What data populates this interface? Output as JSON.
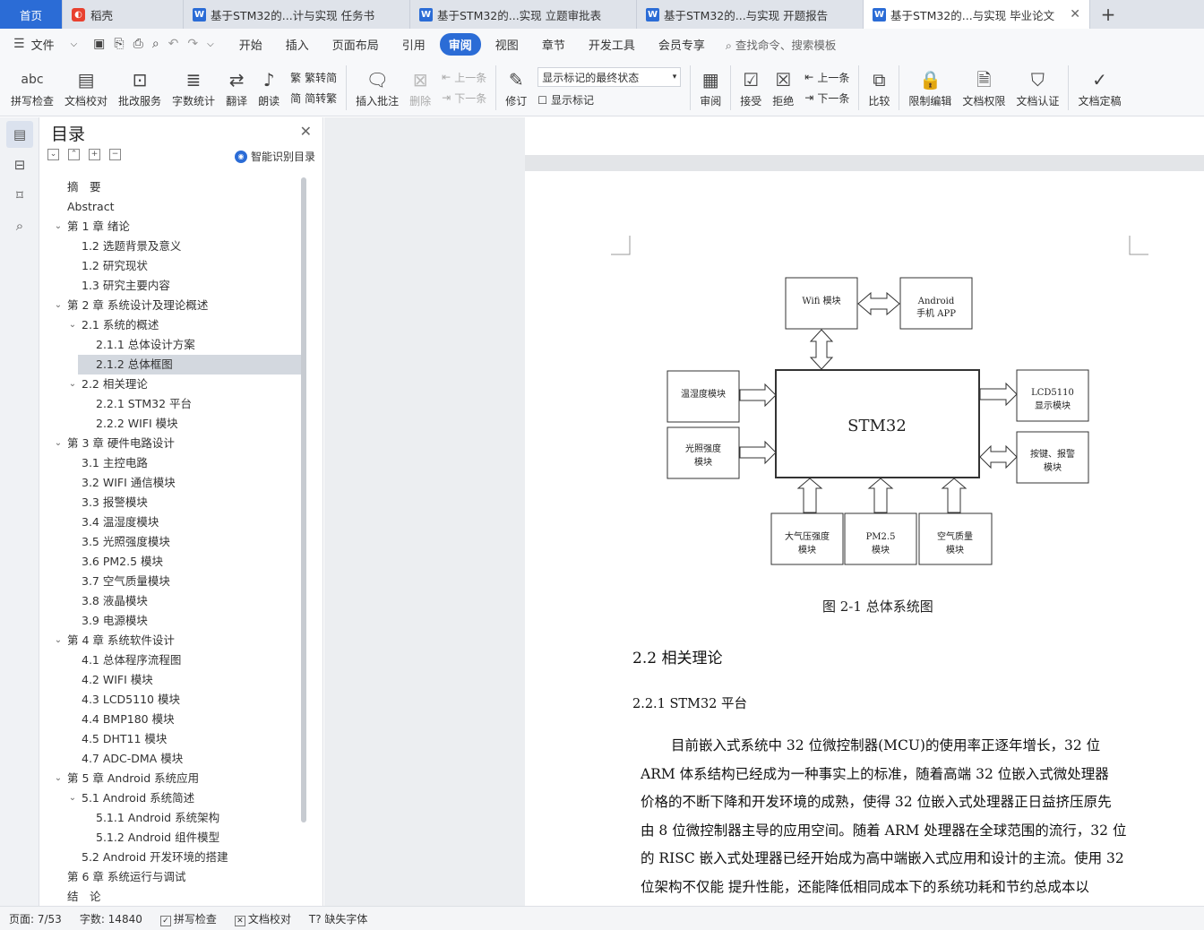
{
  "tabs": [
    {
      "label": "首页",
      "kind": "home"
    },
    {
      "label": "稻壳",
      "kind": "docer"
    },
    {
      "label": "基于STM32的...计与实现 任务书",
      "kind": "doc"
    },
    {
      "label": "基于STM32的...实现 立题审批表",
      "kind": "doc"
    },
    {
      "label": "基于STM32的...与实现 开题报告",
      "kind": "doc"
    },
    {
      "label": "基于STM32的...与实现 毕业论文",
      "kind": "doc",
      "active": true
    }
  ],
  "menu": {
    "file": "文件",
    "items": [
      "开始",
      "插入",
      "页面布局",
      "引用",
      "审阅",
      "视图",
      "章节",
      "开发工具",
      "会员专享"
    ],
    "active": "审阅",
    "search": "查找命令、搜索模板"
  },
  "ribbon": {
    "spell": "拼写检查",
    "proof": "文档校对",
    "review_service": "批改服务",
    "word_count": "字数统计",
    "translate": "翻译",
    "read_aloud": "朗读",
    "to_trad": "繁转简",
    "to_simp": "简转繁",
    "insert_comment": "插入批注",
    "delete": "删除",
    "prev": "上一条",
    "next": "下一条",
    "track": "修订",
    "markup_select": "显示标记的最终状态",
    "show_markup": "显示标记",
    "review": "审阅",
    "accept": "接受",
    "reject": "拒绝",
    "prev2": "上一条",
    "next2": "下一条",
    "compare": "比较",
    "restrict": "限制编辑",
    "rights": "文档权限",
    "certify": "文档认证",
    "finalize": "文档定稿"
  },
  "toc": {
    "title": "目录",
    "smart": "智能识别目录",
    "items": [
      {
        "text": "摘　要",
        "level": 0,
        "arrow": false
      },
      {
        "text": "Abstract",
        "level": 0,
        "arrow": false
      },
      {
        "text": "第 1 章  绪论",
        "level": 0,
        "arrow": true
      },
      {
        "text": "1.2  选题背景及意义",
        "level": 1,
        "arrow": false
      },
      {
        "text": "1.2  研究现状",
        "level": 1,
        "arrow": false
      },
      {
        "text": "1.3  研究主要内容",
        "level": 1,
        "arrow": false
      },
      {
        "text": "第 2 章  系统设计及理论概述",
        "level": 0,
        "arrow": true
      },
      {
        "text": "2.1  系统的概述",
        "level": 1,
        "arrow": true
      },
      {
        "text": "2.1.1  总体设计方案",
        "level": 2,
        "arrow": false
      },
      {
        "text": "2.1.2  总体框图",
        "level": 2,
        "arrow": false,
        "selected": true
      },
      {
        "text": "2.2  相关理论",
        "level": 1,
        "arrow": true
      },
      {
        "text": "2.2.1 STM32 平台",
        "level": 2,
        "arrow": false
      },
      {
        "text": "2.2.2 WIFI 模块",
        "level": 2,
        "arrow": false
      },
      {
        "text": "第 3 章  硬件电路设计",
        "level": 0,
        "arrow": true
      },
      {
        "text": "3.1  主控电路",
        "level": 1,
        "arrow": false
      },
      {
        "text": "3.2 WIFI 通信模块",
        "level": 1,
        "arrow": false
      },
      {
        "text": "3.3  报警模块",
        "level": 1,
        "arrow": false
      },
      {
        "text": "3.4  温湿度模块",
        "level": 1,
        "arrow": false
      },
      {
        "text": "3.5  光照强度模块",
        "level": 1,
        "arrow": false
      },
      {
        "text": "3.6 PM2.5 模块",
        "level": 1,
        "arrow": false
      },
      {
        "text": "3.7  空气质量模块",
        "level": 1,
        "arrow": false
      },
      {
        "text": "3.8  液晶模块",
        "level": 1,
        "arrow": false
      },
      {
        "text": "3.9  电源模块",
        "level": 1,
        "arrow": false
      },
      {
        "text": "第 4 章  系统软件设计",
        "level": 0,
        "arrow": true
      },
      {
        "text": "4.1  总体程序流程图",
        "level": 1,
        "arrow": false
      },
      {
        "text": "4.2 WIFI 模块",
        "level": 1,
        "arrow": false
      },
      {
        "text": "4.3 LCD5110 模块",
        "level": 1,
        "arrow": false
      },
      {
        "text": "4.4 BMP180 模块",
        "level": 1,
        "arrow": false
      },
      {
        "text": "4.5 DHT11 模块",
        "level": 1,
        "arrow": false
      },
      {
        "text": "4.7 ADC-DMA 模块",
        "level": 1,
        "arrow": false
      },
      {
        "text": "第 5 章  Android 系统应用",
        "level": 0,
        "arrow": true
      },
      {
        "text": "5.1 Android 系统简述",
        "level": 1,
        "arrow": true
      },
      {
        "text": "5.1.1 Android 系统架构",
        "level": 2,
        "arrow": false
      },
      {
        "text": "5.1.2 Android 组件模型",
        "level": 2,
        "arrow": false
      },
      {
        "text": "5.2 Android 开发环境的搭建",
        "level": 1,
        "arrow": false
      },
      {
        "text": "第 6 章  系统运行与调试",
        "level": 0,
        "arrow": false
      },
      {
        "text": "结　论",
        "level": 0,
        "arrow": false
      }
    ]
  },
  "diagram": {
    "wifi": "Wifi 模块",
    "android_1": "Android",
    "android_2": "手机 APP",
    "temp": "温湿度模块",
    "light_1": "光照强度",
    "light_2": "模块",
    "stm32": "STM32",
    "lcd_1": "LCD5110",
    "lcd_2": "显示模块",
    "key_1": "按键、报警",
    "key_2": "模块",
    "pressure_1": "大气压强度",
    "pressure_2": "模块",
    "pm_1": "PM2.5",
    "pm_2": "模块",
    "air_1": "空气质量",
    "air_2": "模块"
  },
  "doc": {
    "caption": "图 2-1  总体系统图",
    "h2": "2.2  相关理论",
    "h3": "2.2.1 STM32 平台",
    "lines": [
      "目前嵌入式系统中 32 位微控制器(MCU)的使用率正逐年增长，32 位",
      "ARM 体系结构已经成为一种事实上的标准，随着高端  32 位嵌入式微处理器",
      "价格的不断下降和开发环境的成熟，使得 32 位嵌入式处理器正日益挤压原先",
      "由 8 位微控制器主导的应用空间。随着 ARM 处理器在全球范围的流行，32 位",
      "的 RISC 嵌入式处理器已经开始成为高中端嵌入式应用和设计的主流。使用 32",
      "位架构不仅能  提升性能，还能降低相同成本下的系统功耗和节约总成本以"
    ]
  },
  "status": {
    "page": "页面: 7/53",
    "words": "字数: 14840",
    "spell": "拼写检查",
    "proof": "文档校对",
    "font": "缺失字体"
  }
}
